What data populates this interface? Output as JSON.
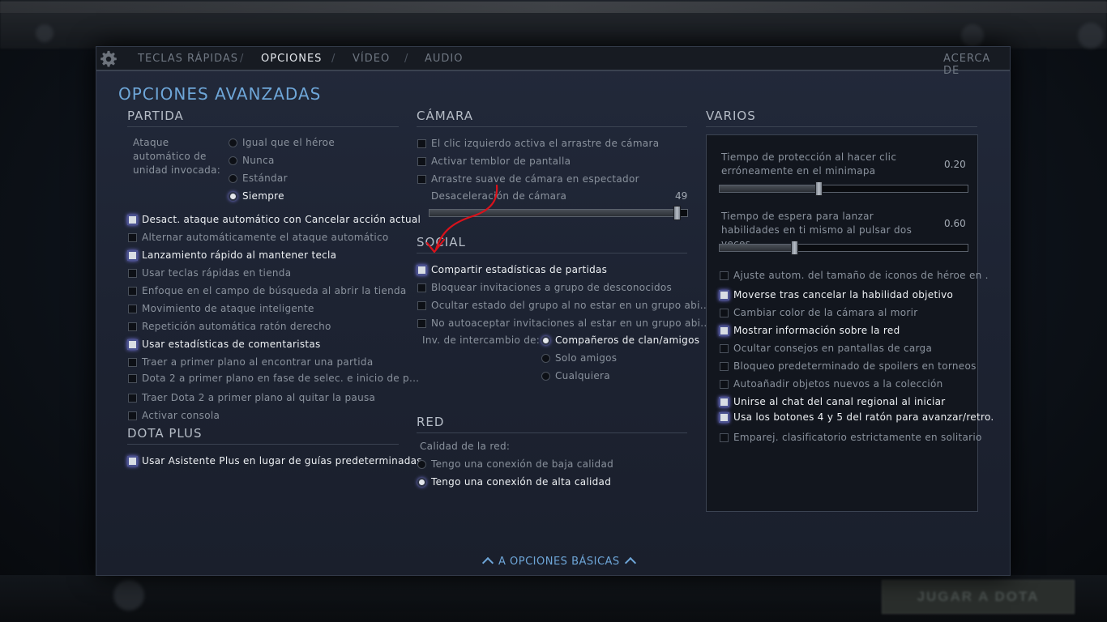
{
  "tabs": {
    "hotkeys": "TECLAS RÁPIDAS",
    "options": "OPCIONES",
    "video": "VÍDEO",
    "audio": "AUDIO",
    "about": "ACERCA DE",
    "separator": "/"
  },
  "title": "OPCIONES AVANZADAS",
  "partida": {
    "heading": "PARTIDA",
    "summon_label": "Ataque automático de unidad invocada:",
    "radios": [
      "Igual que el héroe",
      "Nunca",
      "Estándar",
      "Siempre"
    ],
    "selected_radio": "Siempre",
    "checks": [
      {
        "label": "Desact. ataque automático con Cancelar acción actual",
        "checked": true
      },
      {
        "label": "Alternar automáticamente el ataque automático",
        "checked": false
      },
      {
        "label": "Lanzamiento rápido al mantener tecla",
        "checked": true
      },
      {
        "label": "Usar teclas rápidas en tienda",
        "checked": false
      },
      {
        "label": "Enfoque en el campo de búsqueda al abrir la tienda",
        "checked": false
      },
      {
        "label": "Movimiento de ataque inteligente",
        "checked": false
      },
      {
        "label": "Repetición automática ratón derecho",
        "checked": false
      },
      {
        "label": "Usar estadísticas de comentaristas",
        "checked": true
      },
      {
        "label": "Traer a primer plano al encontrar una partida",
        "checked": false
      },
      {
        "label": "Dota 2 a primer plano en fase de selec. e inicio de p...",
        "checked": false
      },
      {
        "label": "Traer Dota 2 a primer plano al quitar la pausa",
        "checked": false
      },
      {
        "label": "Activar consola",
        "checked": false
      }
    ]
  },
  "dota_plus": {
    "heading": "DOTA PLUS",
    "checks": [
      {
        "label": "Usar Asistente Plus en lugar de guías predeterminadas",
        "checked": true
      }
    ]
  },
  "camara": {
    "heading": "CÁMARA",
    "checks": [
      {
        "label": "El clic izquierdo activa el arrastre de cámara",
        "checked": false
      },
      {
        "label": "Activar temblor de pantalla",
        "checked": false
      },
      {
        "label": "Arrastre suave de cámara en espectador",
        "checked": false
      }
    ],
    "slider_label": "Desaceleración de cámara",
    "slider_value": "49",
    "slider_fraction": 0.96
  },
  "social": {
    "heading": "SOCIAL",
    "checks": [
      {
        "label": "Compartir estadísticas de partidas",
        "checked": true
      },
      {
        "label": "Bloquear invitaciones a grupo de desconocidos",
        "checked": false
      },
      {
        "label": "Ocultar estado del grupo al no estar en un grupo abi...",
        "checked": false
      },
      {
        "label": "No autoaceptar invitaciones al estar en un grupo abi...",
        "checked": false
      }
    ],
    "trade_label": "Inv. de intercambio de:",
    "trade_radios": [
      "Compañeros de clan/amigos",
      "Solo amigos",
      "Cualquiera"
    ],
    "trade_selected": "Compañeros de clan/amigos"
  },
  "red": {
    "heading": "RED",
    "quality_label": "Calidad de la red:",
    "radios": [
      "Tengo una conexión de baja calidad",
      "Tengo una conexión de alta calidad"
    ],
    "selected": "Tengo una conexión de alta calidad"
  },
  "varios": {
    "heading": "VARIOS",
    "slider1_label": "Tiempo de protección al hacer clic erróneamente en el minimapa",
    "slider1_value": "0.20",
    "slider1_fraction": 0.4,
    "slider2_label": "Tiempo de espera para lanzar habilidades en ti mismo al pulsar dos veces",
    "slider2_value": "0.60",
    "slider2_fraction": 0.3,
    "checks": [
      {
        "label": "Ajuste autom. del tamaño de iconos de héroe en .",
        "checked": false
      },
      {
        "label": "Moverse tras cancelar la habilidad objetivo",
        "checked": true
      },
      {
        "label": "Cambiar color de la cámara al morir",
        "checked": false
      },
      {
        "label": "Mostrar información sobre la red",
        "checked": true
      },
      {
        "label": "Ocultar consejos en pantallas de carga",
        "checked": false
      },
      {
        "label": "Bloqueo predeterminado de spoilers en torneos",
        "checked": false
      },
      {
        "label": "Autoañadir objetos nuevos a la colección",
        "checked": false
      },
      {
        "label": "Unirse al chat del canal regional al iniciar",
        "checked": true
      },
      {
        "label": "Usa los botones 4 y 5 del ratón para avanzar/retro.",
        "checked": true
      },
      {
        "label": "Emparej. clasificatorio estrictamente en solitario",
        "checked": false
      }
    ]
  },
  "back_label": "A OPCIONES BÁSICAS",
  "play_button": "JUGAR A DOTA",
  "colors": {
    "accent": "#6ea6d8",
    "annotation": "#d9121b"
  }
}
